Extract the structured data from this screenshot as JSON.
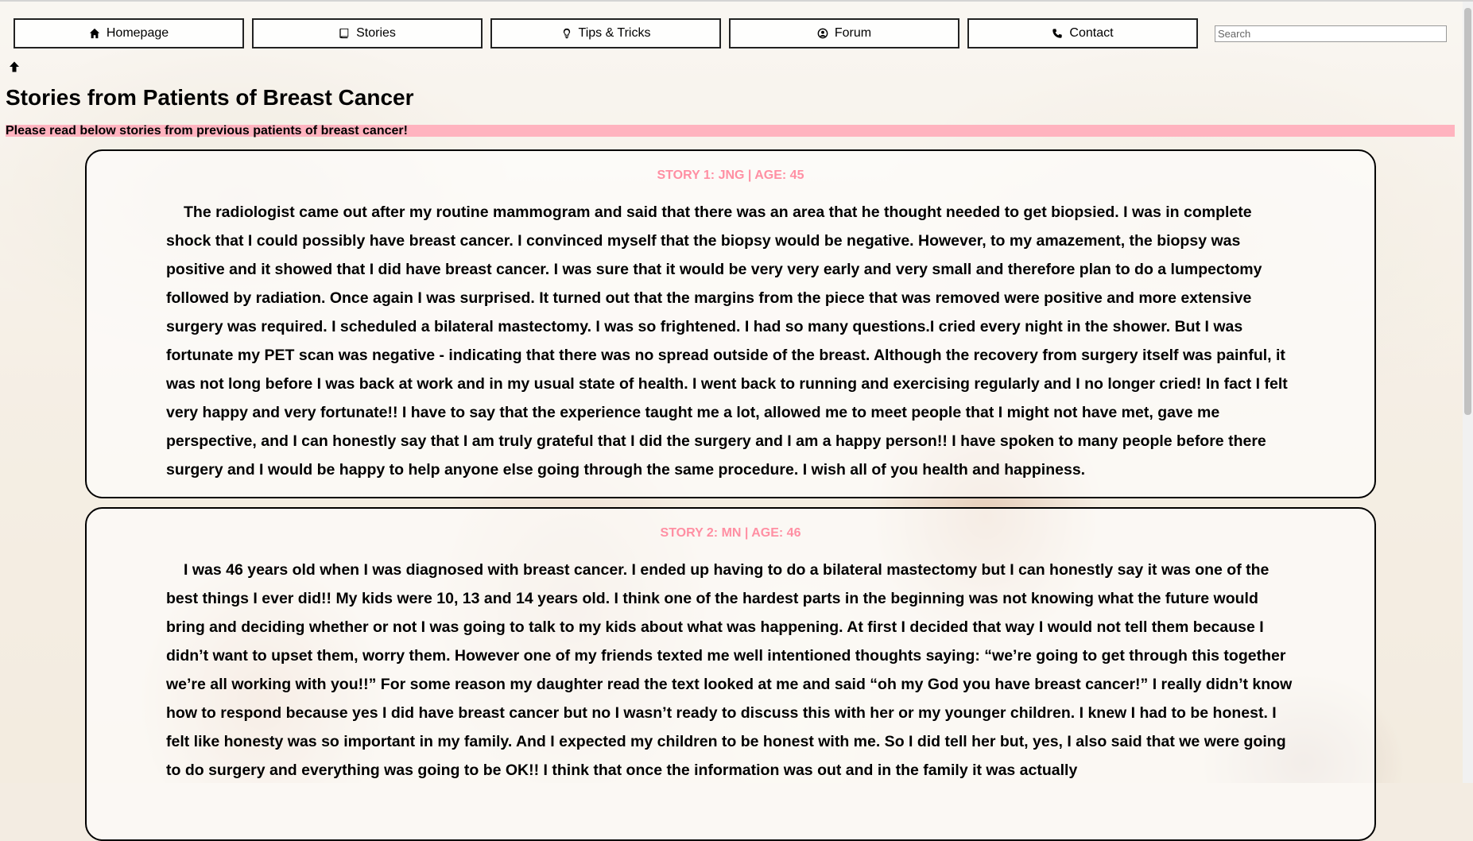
{
  "nav": {
    "items": [
      {
        "label": "Homepage",
        "icon": "home-icon"
      },
      {
        "label": "Stories",
        "icon": "book-icon"
      },
      {
        "label": "Tips & Tricks",
        "icon": "lightbulb-icon"
      },
      {
        "label": "Forum",
        "icon": "user-circle-icon"
      },
      {
        "label": "Contact",
        "icon": "phone-icon"
      }
    ]
  },
  "search": {
    "placeholder": "Search"
  },
  "page": {
    "title": "Stories from Patients of Breast Cancer",
    "subtitle": "Please read below stories from previous patients of breast cancer!",
    "accent_color": "#ff8fa3",
    "banner_color": "#ffb3bf"
  },
  "stories": [
    {
      "heading": "STORY 1: JNG | AGE: 45",
      "body": "The radiologist came out after my routine mammogram and said that there was an area that he thought needed to get biopsied. I was in complete shock that I could possibly have breast cancer. I convinced myself that the biopsy would be negative. However, to my amazement, the biopsy was positive and it showed that I did have breast cancer. I was sure that it would be very very early and very small and therefore plan to do a lumpectomy followed by radiation. Once again I was surprised. It turned out that the margins from the piece that was removed were positive and more extensive surgery was required. I scheduled a bilateral mastectomy. I was so frightened. I had so many questions.I cried every night in the shower. But I was fortunate my PET scan was negative - indicating that there was no spread outside of the breast. Although the recovery from surgery itself was painful, it was not long before I was back at work and in my usual state of health. I went back to running and exercising regularly and I no longer cried! In fact I felt very happy and very fortunate!! I have to say that the experience taught me a lot, allowed me to meet people that I might not have met, gave me perspective, and I can honestly say that I am truly grateful that I did the surgery and I am a happy person!! I have spoken to many people before there surgery and I would be happy to help anyone else going through the same procedure. I wish all of you health and happiness."
    },
    {
      "heading": "STORY 2: MN | AGE: 46",
      "body": "I was 46 years old when I was diagnosed with breast cancer. I ended up having to do a bilateral mastectomy but I can honestly say it was one of the best things I ever did!! My kids were 10, 13 and 14 years old. I think one of the hardest parts in the beginning was not knowing what the future would bring and deciding whether or not I was going to talk to my kids about what was happening. At first I decided that way I would not tell them because I didn’t want to upset them, worry them. However one of my friends texted me well intentioned thoughts saying: “we’re going to get through this together we’re all working with you!!” For some reason my daughter read the text looked at me and said “oh my God you have breast cancer!” I really didn’t know how to respond because yes I did have breast cancer but no I wasn’t ready to discuss this with her or my younger children. I knew I had to be honest. I felt like honesty was so important in my family. And I expected my children to be honest with me. So I did tell her but, yes, I also said that we were going to do surgery and everything was going to be OK!! I think that once the information was out and in the family it was actually"
    }
  ]
}
